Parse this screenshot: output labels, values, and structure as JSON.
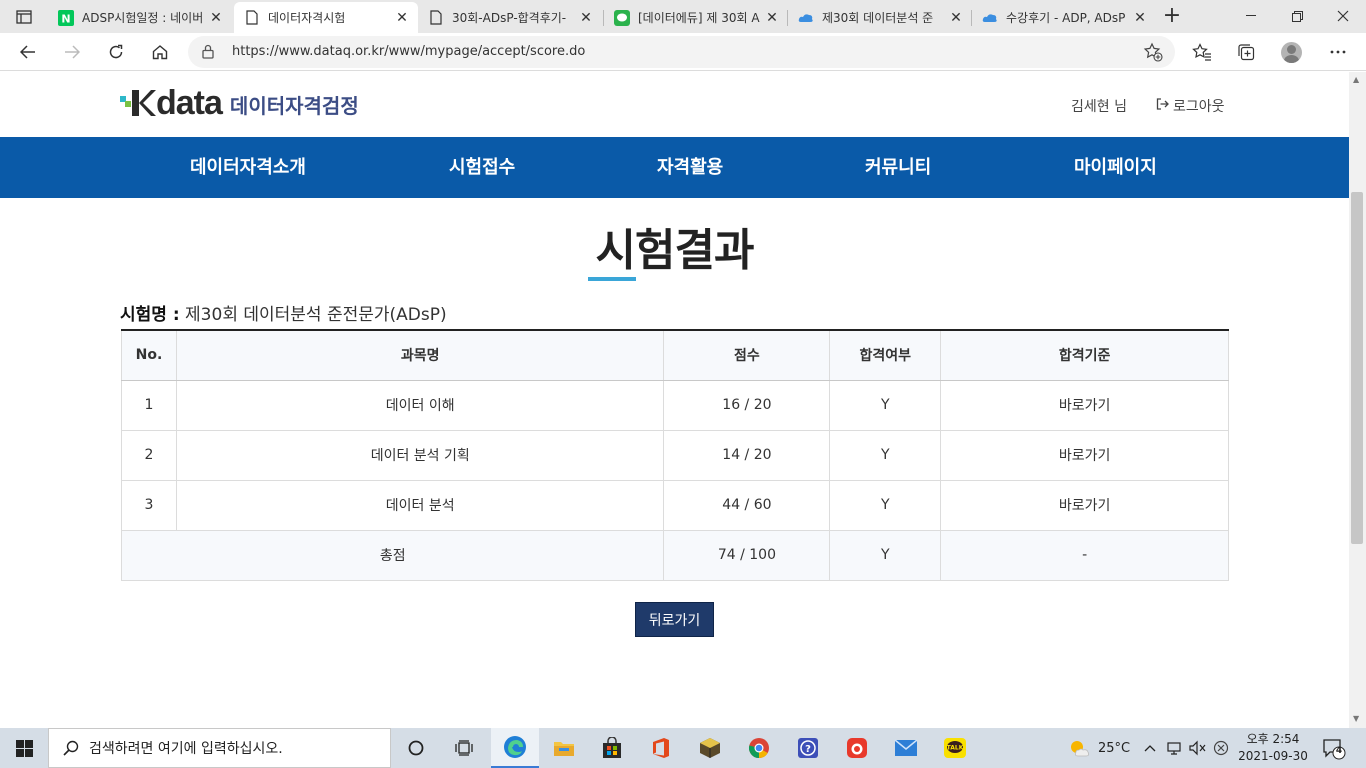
{
  "browser": {
    "tabs": [
      {
        "title": "ADSP시험일정 : 네이버",
        "icon": "naver-icon"
      },
      {
        "title": "데이터자격시험",
        "icon": "page-icon",
        "active": true
      },
      {
        "title": "30회-ADsP-합격후기-",
        "icon": "page-icon"
      },
      {
        "title": "[데이터에듀] 제 30회 A",
        "icon": "green-chat-icon"
      },
      {
        "title": "제30회 데이터분석 준",
        "icon": "blue-cloud-icon"
      },
      {
        "title": "수강후기 - ADP, ADsP",
        "icon": "blue-cloud-icon"
      }
    ],
    "url": "https://www.dataq.or.kr/www/mypage/accept/score.do"
  },
  "site": {
    "logo_text": "data",
    "logo_sub": "데이터자격검정",
    "user_name": "김세현 님",
    "logout_label": "로그아웃",
    "nav": [
      "데이터자격소개",
      "시험접수",
      "자격활용",
      "커뮤니티",
      "마이페이지"
    ]
  },
  "main": {
    "title": "시험결과",
    "exam_label": "시험명 :",
    "exam_name": "제30회 데이터분석 준전문가(ADsP)",
    "table": {
      "headers": [
        "No.",
        "과목명",
        "점수",
        "합격여부",
        "합격기준"
      ],
      "rows": [
        {
          "no": "1",
          "subject": "데이터 이해",
          "score": "16 / 20",
          "pass": "Y",
          "criteria": "바로가기"
        },
        {
          "no": "2",
          "subject": "데이터 분석 기획",
          "score": "14 / 20",
          "pass": "Y",
          "criteria": "바로가기"
        },
        {
          "no": "3",
          "subject": "데이터 분석",
          "score": "44 / 60",
          "pass": "Y",
          "criteria": "바로가기"
        }
      ],
      "total": {
        "label": "총점",
        "score": "74 / 100",
        "pass": "Y",
        "criteria": "-"
      }
    },
    "back_label": "뒤로가기"
  },
  "taskbar": {
    "search_placeholder": "검색하려면 여기에 입력하십시오.",
    "weather": "25°C",
    "time": "오후 2:54",
    "date": "2021-09-30",
    "notification_count": "4"
  },
  "colors": {
    "nav_bg": "#0a5aa8",
    "title_accent": "#3aa6d8",
    "back_button": "#1f3a6a",
    "logo_sub": "#3c4d85"
  }
}
